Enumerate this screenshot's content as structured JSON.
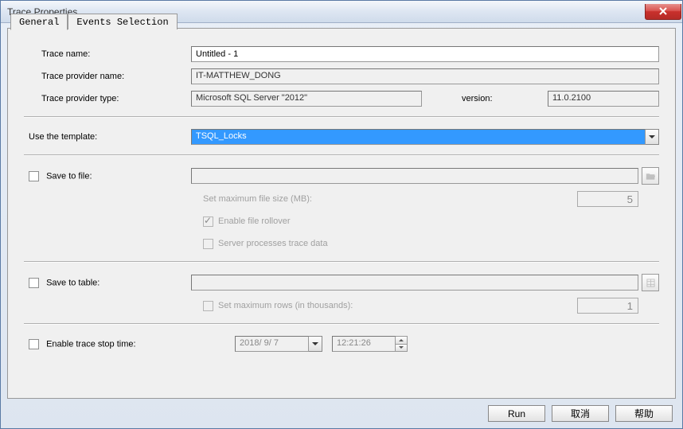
{
  "window": {
    "title": "Trace Properties"
  },
  "tabs": {
    "general": "General",
    "events": "Events Selection"
  },
  "general": {
    "trace_name_label": "Trace name:",
    "trace_name_value": "Untitled - 1",
    "provider_name_label": "Trace provider name:",
    "provider_name_value": "IT-MATTHEW_DONG",
    "provider_type_label": "Trace provider type:",
    "provider_type_value": "Microsoft SQL Server \"2012\"",
    "version_label": "version:",
    "version_value": "11.0.2100",
    "template_label": "Use the template:",
    "template_value": "TSQL_Locks",
    "save_file_label": "Save to file:",
    "save_file_value": "",
    "max_file_label": "Set maximum file size (MB):",
    "max_file_value": "5",
    "rollover_label": "Enable file rollover",
    "server_processes_label": "Server processes trace data",
    "save_table_label": "Save to table:",
    "save_table_value": "",
    "max_rows_label": "Set maximum rows (in thousands):",
    "max_rows_value": "1",
    "stop_time_label": "Enable trace stop time:",
    "stop_date_value": "2018/ 9/ 7",
    "stop_time_value": "12:21:26"
  },
  "buttons": {
    "run": "Run",
    "cancel": "取消",
    "help": "帮助"
  }
}
